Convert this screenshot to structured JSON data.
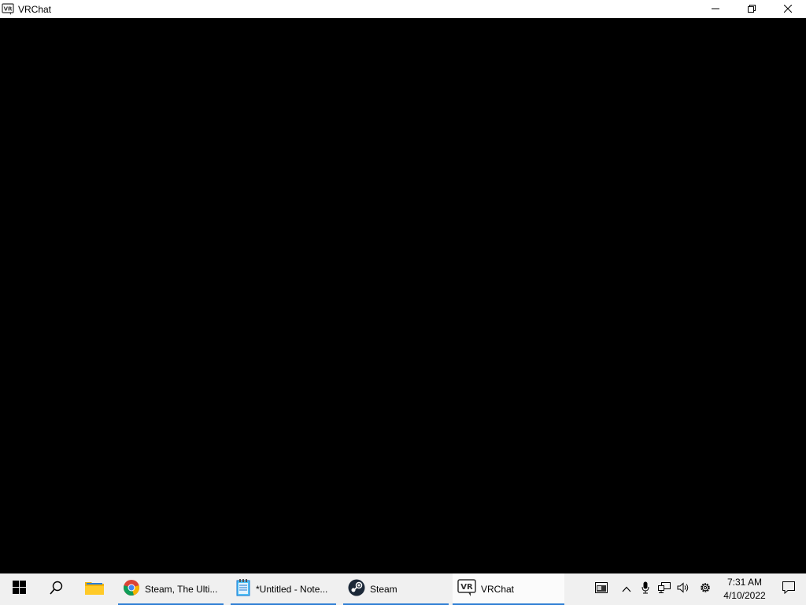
{
  "window": {
    "title": "VRChat",
    "app_icon": "vrchat-icon",
    "controls": [
      "minimize-icon",
      "restore-icon",
      "close-icon"
    ]
  },
  "taskbar": {
    "start_icon": "windows-start-icon",
    "search_icon": "search-icon",
    "pinned": [
      {
        "name": "file-explorer",
        "icon": "folder-icon"
      }
    ],
    "apps": [
      {
        "label": "Steam, The Ulti...",
        "icon": "chrome-icon"
      },
      {
        "label": "*Untitled - Note...",
        "icon": "notepad-icon"
      },
      {
        "label": "Steam",
        "icon": "steam-icon"
      },
      {
        "label": "VRChat",
        "icon": "vrchat-icon"
      }
    ],
    "tray": {
      "icons": [
        "news-widget-icon",
        "chevron-up-icon",
        "microphone-icon",
        "network-icon",
        "speaker-icon",
        "gear-icon"
      ],
      "time": "7:31 AM",
      "date": "4/10/2022",
      "notification_icon": "notification-icon"
    }
  },
  "colors": {
    "accent_underline": "#2f7fd4",
    "taskbar_bg": "#f0f0f0",
    "content_bg": "#000000"
  }
}
